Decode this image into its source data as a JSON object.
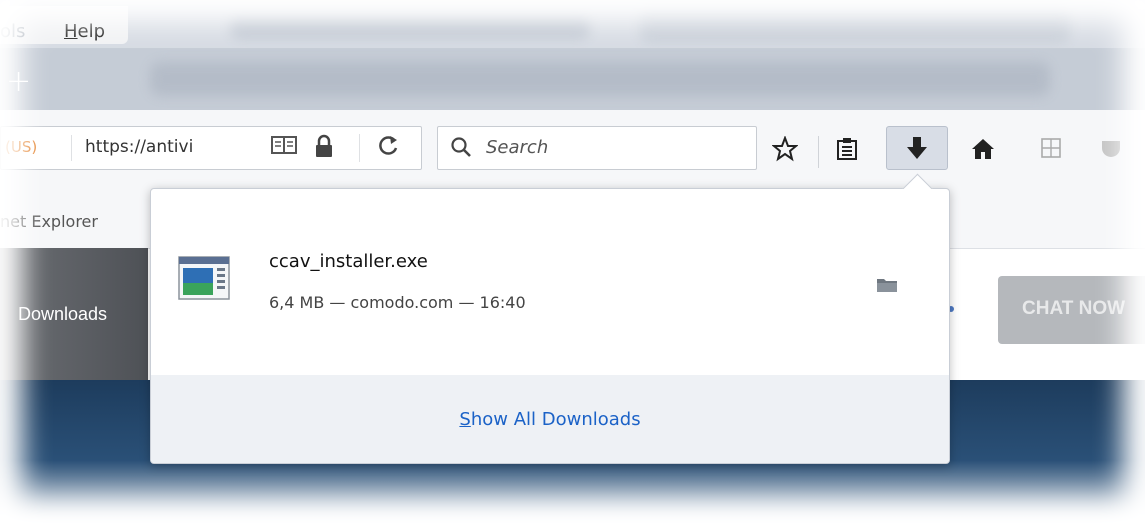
{
  "menubar": {
    "tools_fragment": "ols",
    "help_label": "Help",
    "help_accesskey": "H",
    "help_rest": "elp"
  },
  "tabstrip": {
    "newtab_symbol": "+"
  },
  "navbar": {
    "identity_label": "(US)",
    "url_text": "https://antivi",
    "search_placeholder": "Search",
    "icons": [
      "reader-view-icon",
      "lock-icon",
      "reload-icon",
      "search-icon",
      "bookmark-star-icon",
      "reading-list-icon",
      "download-arrow-icon",
      "home-icon",
      "windows-icon",
      "pocket-icon"
    ]
  },
  "bookmarks": {
    "item_label": "net Explorer"
  },
  "page": {
    "dark_tab_label": "Downloads",
    "chat_label": "CHAT NOW"
  },
  "downloads_panel": {
    "item": {
      "file_name": "ccav_installer.exe",
      "status": "6,4 MB — comodo.com — 16:40",
      "icons": [
        "exe-file-icon",
        "folder-icon"
      ]
    },
    "footer": {
      "show_all_accesskey": "S",
      "show_all_rest": "how All Downloads"
    }
  },
  "colors": {
    "menubar_bg": "#d6dbe3",
    "navbar_bg": "#f6f7f9",
    "downloads_button_active": "#d8dde6",
    "link_blue": "#1b62c7",
    "banner_dark": "#1d3c5d"
  }
}
